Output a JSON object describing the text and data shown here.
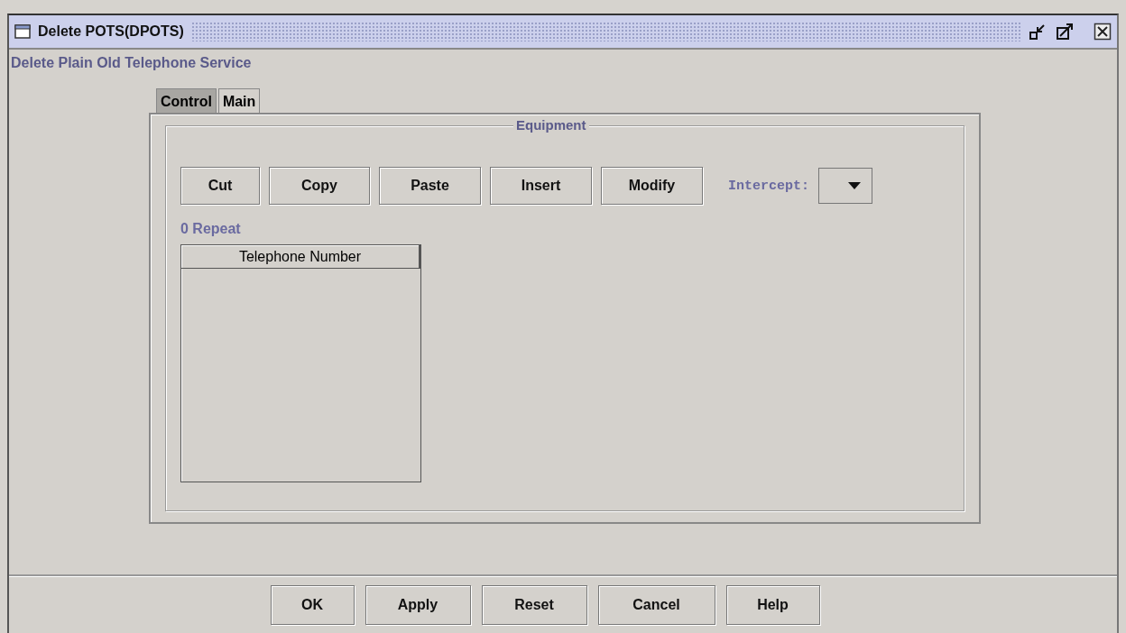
{
  "window": {
    "title": "Delete POTS(DPOTS)"
  },
  "subtitle": "Delete Plain Old Telephone Service",
  "tabs": [
    {
      "label": "Control",
      "selected": true
    },
    {
      "label": "Main",
      "selected": false
    }
  ],
  "group": {
    "title": "Equipment",
    "buttons": [
      "Cut",
      "Copy",
      "Paste",
      "Insert",
      "Modify"
    ],
    "intercept": {
      "label": "Intercept:"
    },
    "repeat_label": "0 Repeat",
    "table": {
      "columns": [
        "Telephone Number"
      ]
    }
  },
  "buttons": [
    "OK",
    "Apply",
    "Reset",
    "Cancel",
    "Help"
  ]
}
